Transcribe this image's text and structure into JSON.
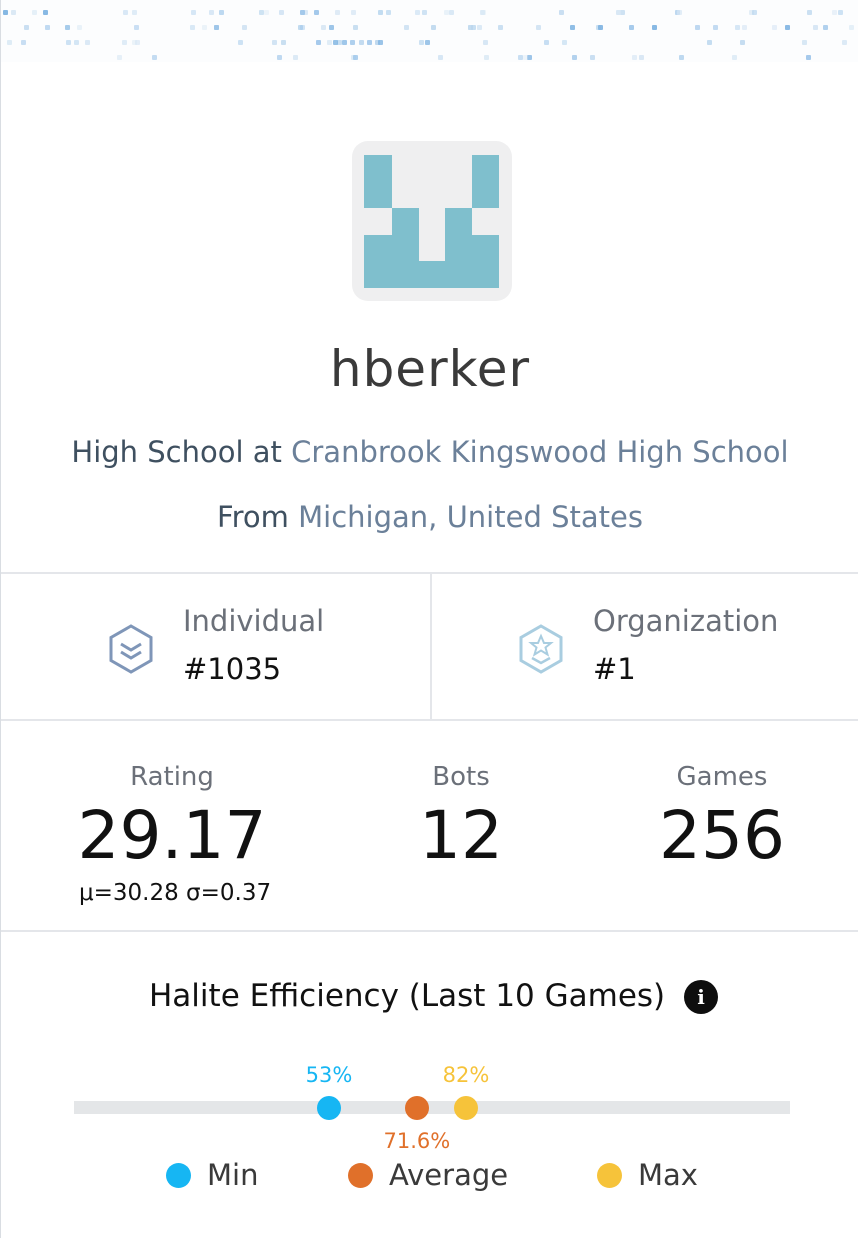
{
  "profile": {
    "username": "hberker",
    "level_prefix": "High School at ",
    "organization": "Cranbrook Kingswood High School",
    "from_prefix": "From ",
    "location": "Michigan, United States"
  },
  "ranks": {
    "individual": {
      "label": "Individual",
      "value": "#1035"
    },
    "organization": {
      "label": "Organization",
      "value": "#1"
    }
  },
  "stats": {
    "rating": {
      "label": "Rating",
      "value": "29.17",
      "detail": "μ=30.28 σ=0.37"
    },
    "bots": {
      "label": "Bots",
      "value": "12"
    },
    "games": {
      "label": "Games",
      "value": "256"
    }
  },
  "efficiency": {
    "title": "Halite Efficiency (Last 10 Games)",
    "info_icon": "info-icon",
    "min": {
      "label": "53%",
      "value": 53,
      "color": "#16b6f3"
    },
    "average": {
      "label": "71.6%",
      "value": 71.6,
      "color": "#e0702a"
    },
    "max": {
      "label": "82%",
      "value": 82,
      "color": "#f6c33a"
    },
    "legend": {
      "min": "Min",
      "average": "Average",
      "max": "Max"
    }
  },
  "colors": {
    "avatar": "#7fbfcd",
    "link": "#6b8099",
    "rank_icon_individual": "#7f96b8",
    "rank_icon_organization": "#a9cde0"
  }
}
